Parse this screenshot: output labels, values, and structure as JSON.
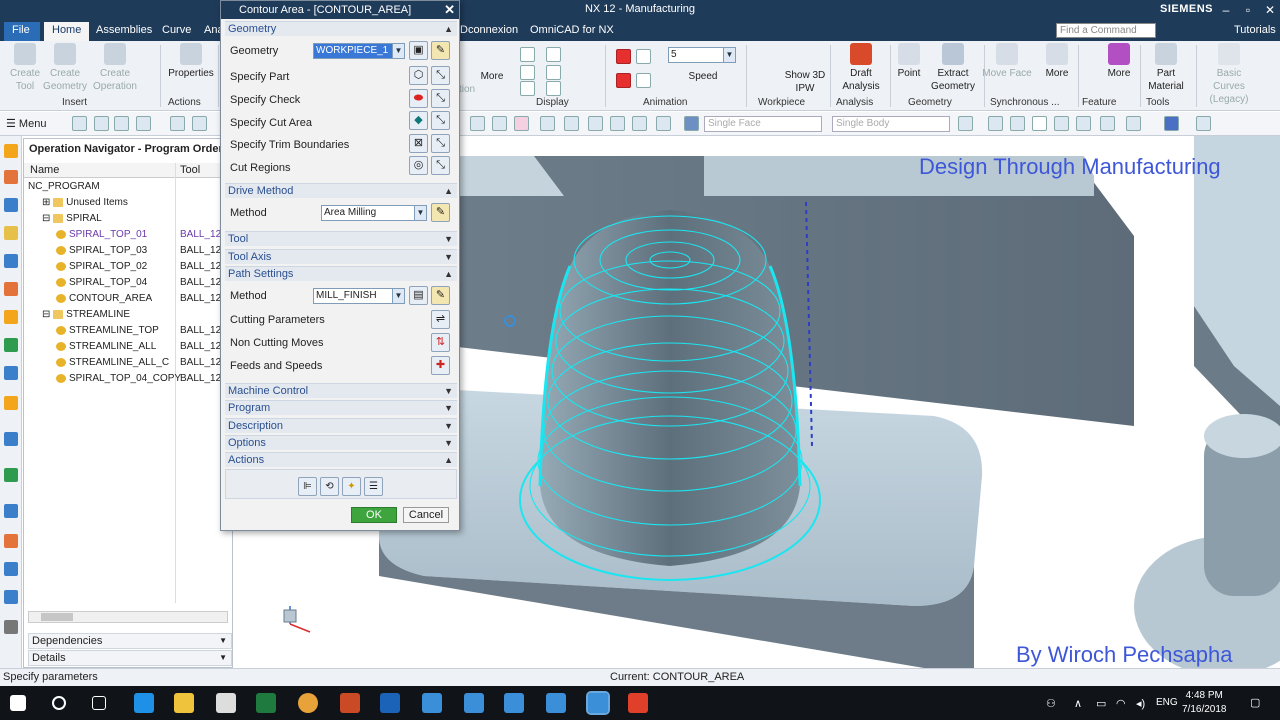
{
  "window": {
    "title": "NX 12 - Manufacturing",
    "brand": "SIEMENS",
    "tutorials": "Tutorials",
    "search_placeholder": "Find a Command"
  },
  "tabs": [
    "File",
    "Home",
    "Assemblies",
    "Curve",
    "Ana"
  ],
  "tabs_right": [
    "Dconnexion",
    "OmniCAD for NX"
  ],
  "ribbon": {
    "insert": {
      "create_tool": "Create Tool",
      "create_geometry": "Create Geometry",
      "create_operation": "Create Operation",
      "group": "Insert"
    },
    "actions": {
      "properties": "Properties",
      "group": "Actions"
    },
    "more1": "More",
    "tion": "tion",
    "display_group": "Display",
    "animation": {
      "speed_value": "5",
      "speed": "Speed",
      "group": "Animation"
    },
    "workpiece": {
      "show_ipw": "Show 3D IPW",
      "group": "Workpiece"
    },
    "analysis": {
      "draft": "Draft Analysis",
      "group": "Analysis"
    },
    "geometry": {
      "point": "Point",
      "extract": "Extract Geometry",
      "group": "Geometry"
    },
    "synchronous": {
      "move_face": "Move Face",
      "more": "More",
      "group": "Synchronous ..."
    },
    "feature": {
      "more": "More",
      "group": "Feature"
    },
    "tools": {
      "part_material": "Part Material",
      "group": "Tools"
    },
    "basic_curves": "Basic Curves (Legacy)"
  },
  "toolbar": {
    "menu": "Menu",
    "single_face": "Single Face",
    "single_body": "Single Body"
  },
  "navigator": {
    "title": "Operation Navigator - Program Order",
    "col_name": "Name",
    "col_tool": "Tool",
    "rows": [
      {
        "name": "NC_PROGRAM",
        "tool": "",
        "level": 0,
        "expander": ""
      },
      {
        "name": "Unused Items",
        "tool": "",
        "level": 1,
        "expander": "+"
      },
      {
        "name": "SPIRAL",
        "tool": "",
        "level": 1,
        "expander": "-"
      },
      {
        "name": "SPIRAL_TOP_01",
        "tool": "BALL_12",
        "level": 2,
        "expander": "",
        "highlight": true
      },
      {
        "name": "SPIRAL_TOP_03",
        "tool": "BALL_12",
        "level": 2,
        "expander": ""
      },
      {
        "name": "SPIRAL_TOP_02",
        "tool": "BALL_12",
        "level": 2,
        "expander": ""
      },
      {
        "name": "SPIRAL_TOP_04",
        "tool": "BALL_12",
        "level": 2,
        "expander": ""
      },
      {
        "name": "CONTOUR_AREA",
        "tool": "BALL_12",
        "level": 2,
        "expander": ""
      },
      {
        "name": "STREAMLINE",
        "tool": "",
        "level": 1,
        "expander": "-"
      },
      {
        "name": "STREAMLINE_TOP",
        "tool": "BALL_12",
        "level": 2,
        "expander": ""
      },
      {
        "name": "STREAMLINE_ALL",
        "tool": "BALL_12",
        "level": 2,
        "expander": ""
      },
      {
        "name": "STREAMLINE_ALL_C",
        "tool": "BALL_12",
        "level": 2,
        "expander": ""
      },
      {
        "name": "SPIRAL_TOP_04_COPY",
        "tool": "BALL_12",
        "level": 2,
        "expander": ""
      }
    ],
    "dependencies": "Dependencies",
    "details": "Details"
  },
  "dialog": {
    "title": "Contour Area - [CONTOUR_AREA]",
    "sections": {
      "geometry": "Geometry",
      "drive_method": "Drive Method",
      "tool": "Tool",
      "tool_axis": "Tool Axis",
      "path_settings": "Path Settings",
      "machine_control": "Machine Control",
      "program": "Program",
      "description": "Description",
      "options": "Options",
      "actions": "Actions"
    },
    "geometry_label": "Geometry",
    "geometry_value": "WORKPIECE_1",
    "specify_part": "Specify Part",
    "specify_check": "Specify Check",
    "specify_cut_area": "Specify Cut Area",
    "specify_trim": "Specify Trim Boundaries",
    "cut_regions": "Cut Regions",
    "drive_method_label": "Method",
    "drive_method_value": "Area Milling",
    "path_method_label": "Method",
    "path_method_value": "MILL_FINISH",
    "cutting_parameters": "Cutting Parameters",
    "non_cutting_moves": "Non Cutting Moves",
    "feeds_and_speeds": "Feeds and Speeds",
    "ok": "OK",
    "cancel": "Cancel"
  },
  "viewport": {
    "watermark_title": "Design Through Manufacturing",
    "watermark_author": "By Wiroch  Pechsapha",
    "toolpath_color": "#19e6f0"
  },
  "status": {
    "left": "Specify parameters",
    "current": "Current: CONTOUR_AREA"
  },
  "taskbar": {
    "lang": "ENG",
    "time": "4:48 PM",
    "date": "7/16/2018"
  }
}
